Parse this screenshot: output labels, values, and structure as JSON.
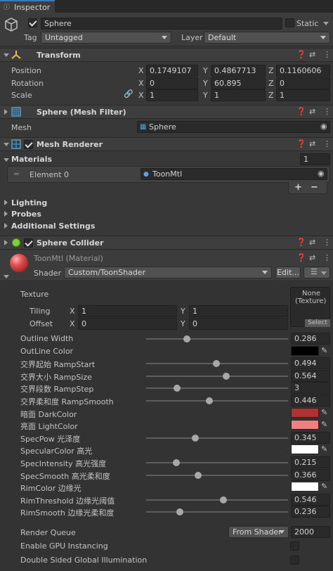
{
  "tab": {
    "title": "Inspector"
  },
  "object": {
    "name": "Sphere",
    "static_label": "Static",
    "tag_label": "Tag",
    "tag_value": "Untagged",
    "layer_label": "Layer",
    "layer_value": "Default"
  },
  "transform": {
    "title": "Transform",
    "position_label": "Position",
    "rotation_label": "Rotation",
    "scale_label": "Scale",
    "position": {
      "x": "0.1749107",
      "y": "0.4867713",
      "z": "0.1160606"
    },
    "rotation": {
      "x": "0",
      "y": "60.895",
      "z": "0"
    },
    "scale": {
      "x": "1",
      "y": "1",
      "z": "1"
    },
    "axis": {
      "x": "X",
      "y": "Y",
      "z": "Z"
    }
  },
  "mesh_filter": {
    "title": "Sphere (Mesh Filter)",
    "mesh_label": "Mesh",
    "mesh_value": "Sphere"
  },
  "mesh_renderer": {
    "title": "Mesh Renderer",
    "materials_label": "Materials",
    "materials_count": "1",
    "element_label": "Element 0",
    "element_value": "ToonMtl",
    "add": "+",
    "remove": "−",
    "lighting": "Lighting",
    "probes": "Probes",
    "additional": "Additional Settings"
  },
  "collider": {
    "title": "Sphere Collider"
  },
  "material": {
    "title": "ToonMtl (Material)",
    "shader_label": "Shader",
    "shader_value": "Custom/ToonShader",
    "edit_label": "Edit...",
    "texture_label": "Texture",
    "texture_none": "None",
    "texture_type": "(Texture)",
    "texture_select": "Select",
    "tiling_label": "Tiling",
    "offset_label": "Offset",
    "tiling": {
      "x": "1",
      "y": "1"
    },
    "offset": {
      "x": "0",
      "y": "0"
    }
  },
  "properties": [
    {
      "label": "Outline Width",
      "kind": "slider",
      "value": "0.286",
      "fraction": 0.286
    },
    {
      "label": "OutLine Color",
      "kind": "color",
      "color": "#000000"
    },
    {
      "label": "交界起始 RampStart",
      "kind": "slider",
      "value": "0.494",
      "fraction": 0.494
    },
    {
      "label": "交界大小 RampSize",
      "kind": "slider",
      "value": "0.564",
      "fraction": 0.564
    },
    {
      "label": "交界段数 RampStep",
      "kind": "slider",
      "value": "3",
      "fraction": 0.22
    },
    {
      "label": "交界柔和度 RampSmooth",
      "kind": "slider",
      "value": "0.446",
      "fraction": 0.446
    },
    {
      "label": "暗面 DarkColor",
      "kind": "color",
      "color": "#b23232"
    },
    {
      "label": "亮面 LightColor",
      "kind": "color",
      "color": "#f08080"
    },
    {
      "label": "SpecPow 光泽度",
      "kind": "slider",
      "value": "0.345",
      "fraction": 0.345
    },
    {
      "label": "SpecularColor 高光",
      "kind": "color",
      "color": "#ffffff"
    },
    {
      "label": "SpecIntensity 高光强度",
      "kind": "slider",
      "value": "0.215",
      "fraction": 0.215
    },
    {
      "label": "SpecSmooth 高光柔和度",
      "kind": "slider",
      "value": "0.366",
      "fraction": 0.366
    },
    {
      "label": "RimColor 边缘光",
      "kind": "color",
      "color": "#ffffff"
    },
    {
      "label": "RimThreshold 边缘光阈值",
      "kind": "slider",
      "value": "0.546",
      "fraction": 0.546
    },
    {
      "label": "RimSmooth 边缘光柔和度",
      "kind": "slider",
      "value": "0.236",
      "fraction": 0.236
    }
  ],
  "render": {
    "queue_label": "Render Queue",
    "queue_mode": "From Shader",
    "queue_value": "2000",
    "gpu_label": "Enable GPU Instancing",
    "dsgi_label": "Double Sided Global Illumination"
  },
  "colors": {
    "accent_green": "#7fd13a",
    "transform_axis": "#e0c050",
    "mesh_blue": "#4aa3e0"
  }
}
